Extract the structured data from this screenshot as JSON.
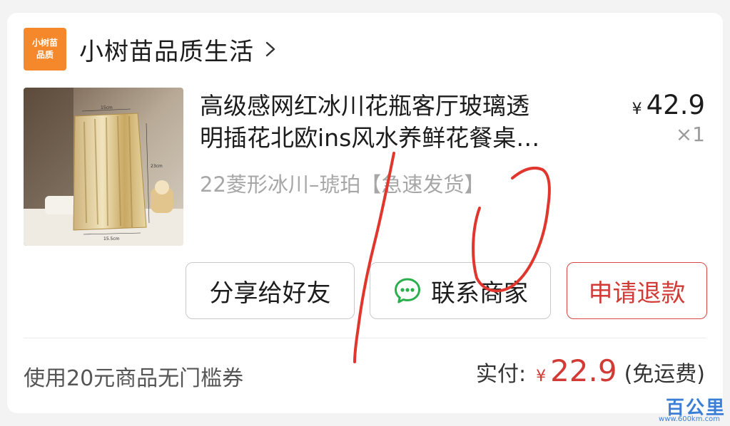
{
  "shop": {
    "logo_line1": "小树苗",
    "logo_line2": "品质",
    "name": "小树苗品质生活",
    "chevron_icon": "chevron-right-icon",
    "logo_color": "#f4882a"
  },
  "product": {
    "title_line1": "高级感网红冰川花瓶客厅玻璃透",
    "title_line2": "明插花北欧ins风水养鲜花餐桌…",
    "price_currency": "¥",
    "price": "42.9",
    "quantity": "×1",
    "variant": "22菱形冰川–琥珀【急速发货】",
    "image_labels": [
      "15cm",
      "23cm",
      "15.5cm"
    ]
  },
  "actions": {
    "share_label": "分享给好友",
    "contact_label": "联系商家",
    "contact_icon": "wechat-chat-icon",
    "refund_label": "申请退款",
    "refund_color": "#d23a35"
  },
  "summary": {
    "coupon_text": "使用20元商品无门槛券",
    "paid_label": "实付:",
    "paid_currency": "¥",
    "paid_amount": "22.9",
    "shipping_note": "(免运费)"
  },
  "annotation": {
    "handwritten_text": "10",
    "ink_color": "#e0362d"
  },
  "watermark": {
    "text": "百公里",
    "url": "www.600km.com"
  }
}
